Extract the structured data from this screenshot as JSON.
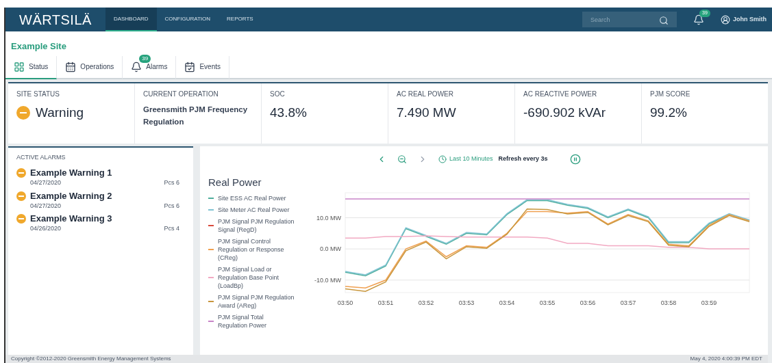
{
  "nav": {
    "logo": "WÄRTSILÄ",
    "items": [
      {
        "label": "DASHBOARD",
        "selected": true
      },
      {
        "label": "CONFIGURATION",
        "selected": false
      },
      {
        "label": "REPORTS",
        "selected": false
      }
    ],
    "search": {
      "placeholder": "Search"
    },
    "notifications": "39",
    "user": "John Smith"
  },
  "site": "Example Site",
  "tabs": [
    {
      "label": "Status",
      "selected": true
    },
    {
      "label": "Operations",
      "selected": false
    },
    {
      "label": "Alarms",
      "selected": false,
      "badge": "39"
    },
    {
      "label": "Events",
      "selected": false
    }
  ],
  "stats": [
    {
      "label": "SITE STATUS",
      "value": "Warning",
      "kind": "status"
    },
    {
      "label": "CURRENT OPERATION",
      "value": "Greensmith PJM Frequency Regulation",
      "kind": "text"
    },
    {
      "label": "SOC",
      "value": "43.8%",
      "kind": "metric"
    },
    {
      "label": "AC REAL POWER",
      "value": "7.490 MW",
      "kind": "metric"
    },
    {
      "label": "AC REACTIVE POWER",
      "value": "-690.902 kVAr",
      "kind": "metric"
    },
    {
      "label": "PJM SCORE",
      "value": "99.2%",
      "kind": "metric"
    }
  ],
  "alarms": {
    "title": "ACTIVE ALARMS",
    "items": [
      {
        "name": "Example Warning 1",
        "date": "04/27/2020",
        "source": "Pcs 6"
      },
      {
        "name": "Example Warning 2",
        "date": "04/27/2020",
        "source": "Pcs 6"
      },
      {
        "name": "Example Warning 3",
        "date": "04/26/2020",
        "source": "Pcs 4"
      }
    ]
  },
  "chart_controls": {
    "range": "Last 10 Minutes",
    "refresh": "Refresh every 3s"
  },
  "chart": {
    "chart_data": {
      "type": "line",
      "title": "Real Power",
      "categories": [
        "03:50",
        null,
        "03:51",
        null,
        "03:52",
        null,
        "03:53",
        null,
        "03:54",
        null,
        "03:55",
        null,
        "03:56",
        null,
        "03:57",
        null,
        "03:58",
        null,
        "03:59",
        null,
        null
      ],
      "ylim": [
        -14,
        18
      ],
      "grid": true,
      "legend": "left",
      "yticks": [
        {
          "value": -10,
          "label": "-10.0 MW"
        },
        {
          "value": 0,
          "label": "0.0 MW"
        },
        {
          "value": 10,
          "label": "10.0 MW"
        }
      ],
      "series": [
        {
          "name": "Site ESS AC Real Power",
          "color": "#4fae9c",
          "values": [
            -7.5,
            -8.6,
            -5.5,
            6.5,
            4,
            1.5,
            5,
            4.5,
            11,
            15.5,
            15.5,
            14,
            13,
            10,
            12.5,
            10,
            2,
            2,
            8,
            11,
            9
          ]
        },
        {
          "name": "Site Meter AC Real Power",
          "color": "#7fc3d3",
          "values": [
            -7.2,
            -8.3,
            -5.2,
            6.8,
            4.3,
            1.8,
            5.3,
            4.8,
            11.3,
            15.8,
            15.8,
            14.3,
            13.3,
            10.3,
            12.8,
            10.3,
            2.3,
            2.3,
            8.3,
            11.3,
            9.3
          ]
        },
        {
          "name": "PJM Signal PJM Regulation Signal (RegD)",
          "color": "#d94a3c",
          "values": [
            null,
            null,
            null,
            null,
            null,
            null,
            null,
            null,
            null,
            null,
            null,
            null,
            null,
            null,
            null,
            null,
            null,
            null,
            null,
            null,
            null
          ]
        },
        {
          "name": "PJM Signal Control Regulation or Response (CReg)",
          "color": "#f0a050",
          "values": [
            -12,
            -12.5,
            -10,
            0,
            2.5,
            -2.5,
            1,
            0.5,
            5,
            12,
            12,
            11.5,
            12,
            8,
            11,
            9,
            1.5,
            1,
            7.5,
            11,
            9
          ]
        },
        {
          "name": "PJM Signal Load or Regulation Base Point (LoadBp)",
          "color": "#f2a9c2",
          "values": [
            3.5,
            3.5,
            4,
            4,
            4.2,
            4,
            3.8,
            3.8,
            3.8,
            3.8,
            3.5,
            1.8,
            1.8,
            1,
            1,
            1,
            0.5,
            0.5,
            0,
            0,
            0
          ]
        },
        {
          "name": "PJM Signal PJM Regulation Award (AReg)",
          "color": "#c8963c",
          "values": [
            -12.8,
            -13.6,
            -10.6,
            -0.6,
            2.2,
            -3.2,
            0.7,
            0.2,
            4.7,
            12.8,
            12.6,
            11.2,
            11.7,
            7.7,
            10.7,
            8.7,
            1.2,
            0.7,
            7.2,
            10.7,
            8.7
          ]
        },
        {
          "name": "PJM Signal Total Regulation Power",
          "color": "#c884c8",
          "values": [
            16,
            16,
            16,
            16,
            16,
            16,
            16,
            16,
            16,
            16,
            16,
            16,
            16,
            16,
            16,
            16,
            16,
            16,
            16,
            16,
            16
          ]
        }
      ]
    }
  },
  "footer": {
    "copyright": "Copyright ©2012-2020 Greensmith Energy Management Systems",
    "timestamp": "May 4, 2020 4:00:39 PM EDT"
  }
}
